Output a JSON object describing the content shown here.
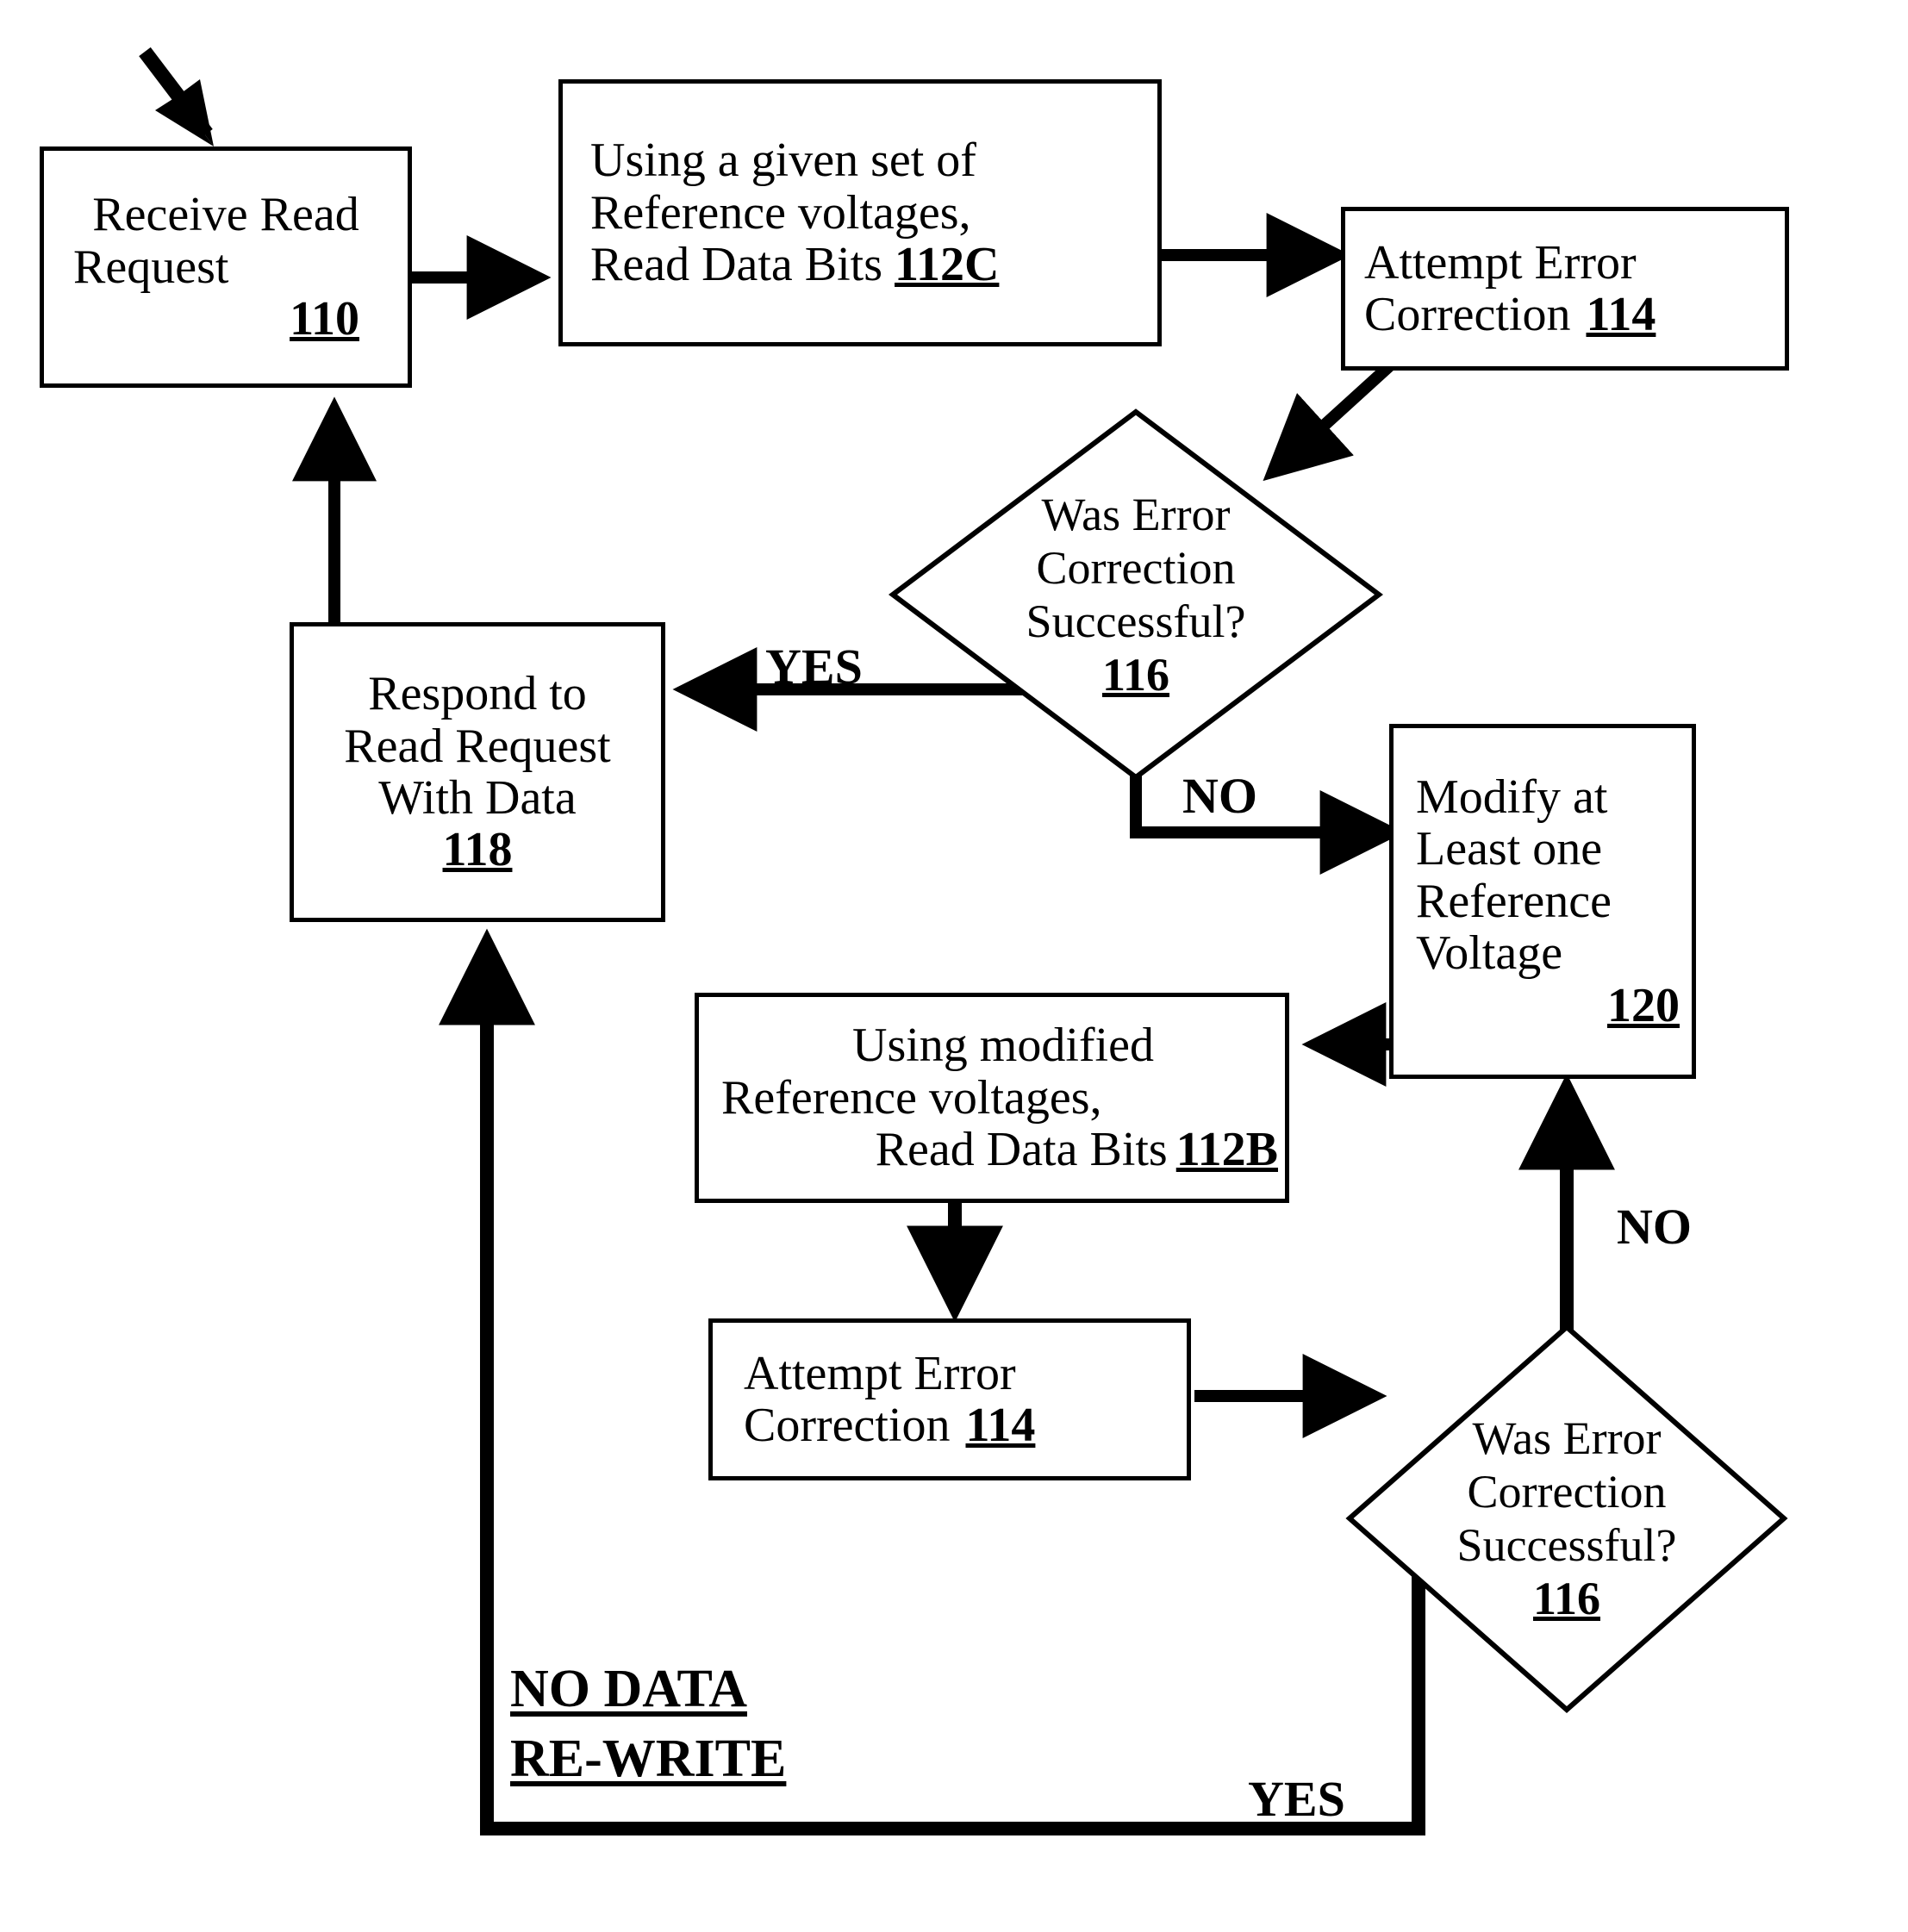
{
  "figure": {
    "type": "flowchart",
    "title": "Read request with reference-voltage retry flow",
    "background_color": "#ffffff",
    "line_color": "#000000"
  },
  "nodes": {
    "receive_read_request": {
      "shape": "process",
      "line1": "Receive Read",
      "line2": "Request",
      "ref": "110"
    },
    "read_given_refs": {
      "shape": "process",
      "line1": "Using a given set of",
      "line2": "Reference voltages,",
      "line3": "Read Data Bits",
      "ref": "112C"
    },
    "attempt_ecc_top": {
      "shape": "process",
      "line1": "Attempt Error",
      "line2": "Correction",
      "ref": "114"
    },
    "decision_top": {
      "shape": "decision",
      "line1": "Was Error",
      "line2": "Correction",
      "line3": "Successful?",
      "ref": "116"
    },
    "respond_with_data": {
      "shape": "process",
      "line1": "Respond to",
      "line2": "Read Request",
      "line3": "With Data",
      "ref": "118"
    },
    "modify_reference_voltage": {
      "shape": "process",
      "line1": "Modify at",
      "line2": "Least one",
      "line3": "Reference",
      "line4": "Voltage",
      "ref": "120"
    },
    "read_modified_refs": {
      "shape": "process",
      "line1": "Using modified",
      "line2": "Reference voltages,",
      "line3": "Read Data Bits",
      "ref": "112B"
    },
    "attempt_ecc_bottom": {
      "shape": "process",
      "line1": "Attempt Error",
      "line2": "Correction",
      "ref": "114"
    },
    "decision_bottom": {
      "shape": "decision",
      "line1": "Was Error",
      "line2": "Correction",
      "line3": "Successful?",
      "ref": "116"
    }
  },
  "edge_labels": {
    "yes_top": "YES",
    "no_top": "NO",
    "no_bottom": "NO",
    "yes_bottom": "YES"
  },
  "annotations": {
    "no_data_rewrite_line1": "NO DATA",
    "no_data_rewrite_line2": "RE-WRITE"
  }
}
